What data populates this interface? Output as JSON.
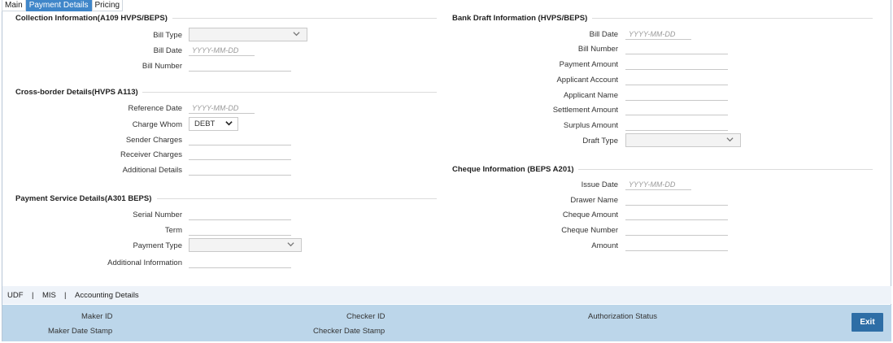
{
  "tabs": [
    {
      "label": "Main"
    },
    {
      "label": "Payment Details"
    },
    {
      "label": "Pricing"
    }
  ],
  "collection": {
    "title": "Collection Information(A109 HVPS/BEPS)",
    "bill_type": "Bill Type",
    "bill_date": "Bill Date",
    "bill_date_ph": "YYYY-MM-DD",
    "bill_number": "Bill Number"
  },
  "crossborder": {
    "title": "Cross-border Details(HVPS A113)",
    "reference_date": "Reference Date",
    "reference_date_ph": "YYYY-MM-DD",
    "charge_whom": "Charge Whom",
    "charge_whom_value": "DEBT",
    "sender_charges": "Sender Charges",
    "receiver_charges": "Receiver Charges",
    "additional_details": "Additional Details"
  },
  "payment_service": {
    "title": "Payment Service Details(A301 BEPS)",
    "serial_number": "Serial Number",
    "term": "Term",
    "payment_type": "Payment Type",
    "additional_information": "Additional Information"
  },
  "bank_draft": {
    "title": "Bank Draft Information (HVPS/BEPS)",
    "bill_date": "Bill Date",
    "bill_date_ph": "YYYY-MM-DD",
    "bill_number": "Bill Number",
    "payment_amount": "Payment Amount",
    "applicant_account": "Applicant Account",
    "applicant_name": "Applicant Name",
    "settlement_amount": "Settlement Amount",
    "surplus_amount": "Surplus Amount",
    "draft_type": "Draft Type"
  },
  "cheque": {
    "title": "Cheque Information (BEPS A201)",
    "issue_date": "Issue Date",
    "issue_date_ph": "YYYY-MM-DD",
    "drawer_name": "Drawer Name",
    "cheque_amount": "Cheque Amount",
    "cheque_number": "Cheque Number",
    "amount": "Amount"
  },
  "footer_links": {
    "udf": "UDF",
    "sep1": "|",
    "mis": "MIS",
    "sep2": "|",
    "accounting": "Accounting Details"
  },
  "audit": {
    "maker_id": "Maker ID",
    "maker_date_stamp": "Maker Date Stamp",
    "checker_id": "Checker ID",
    "checker_date_stamp": "Checker Date Stamp",
    "authorization_status": "Authorization Status",
    "exit": "Exit"
  },
  "icons": {
    "dropdown": "chevron-down-icon"
  },
  "colors": {
    "active_tab": "#3f86c9",
    "footer_bg": "#bcd6ea",
    "exit_button": "#2e6ea6"
  }
}
